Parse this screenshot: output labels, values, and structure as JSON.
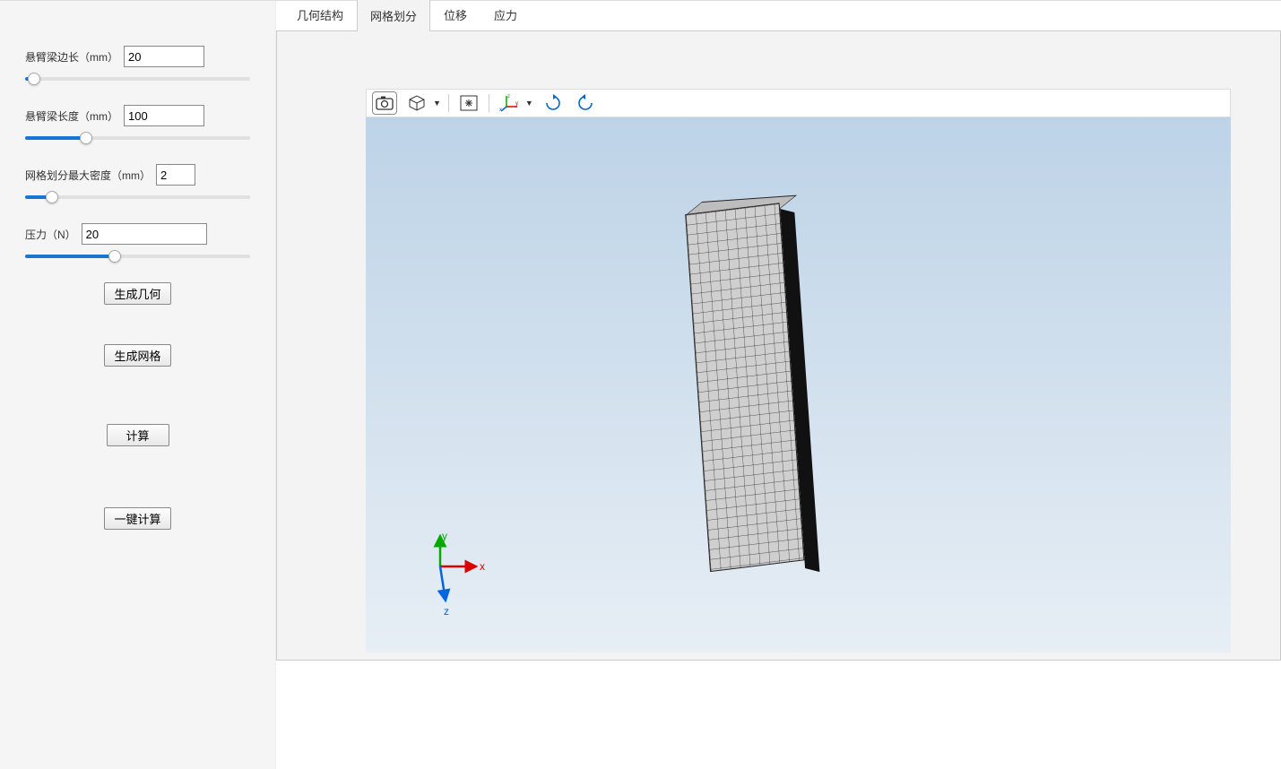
{
  "sidebar": {
    "params": {
      "edge": {
        "label": "悬臂梁边长（mm）",
        "value": "20",
        "fillPct": 4
      },
      "length": {
        "label": "悬臂梁长度（mm）",
        "value": "100",
        "fillPct": 27
      },
      "mesh": {
        "label": "网格划分最大密度（mm）",
        "value": "2",
        "fillPct": 12
      },
      "force": {
        "label": "压力（N）",
        "value": "20",
        "fillPct": 40
      }
    },
    "buttons": {
      "genGeom": "生成几何",
      "genMesh": "生成网格",
      "compute": "计算",
      "oneClick": "一键计算"
    }
  },
  "tabs": {
    "geometry": "几何结构",
    "mesh": "网格划分",
    "displacement": "位移",
    "stress": "应力",
    "active": "mesh"
  },
  "axis": {
    "x": "x",
    "y": "y",
    "z": "z"
  },
  "toolbar": {
    "icons": [
      "camera-icon",
      "cube-icon",
      "fit-icon",
      "axes-icon",
      "rotate-cw-icon",
      "rotate-ccw-icon"
    ]
  }
}
